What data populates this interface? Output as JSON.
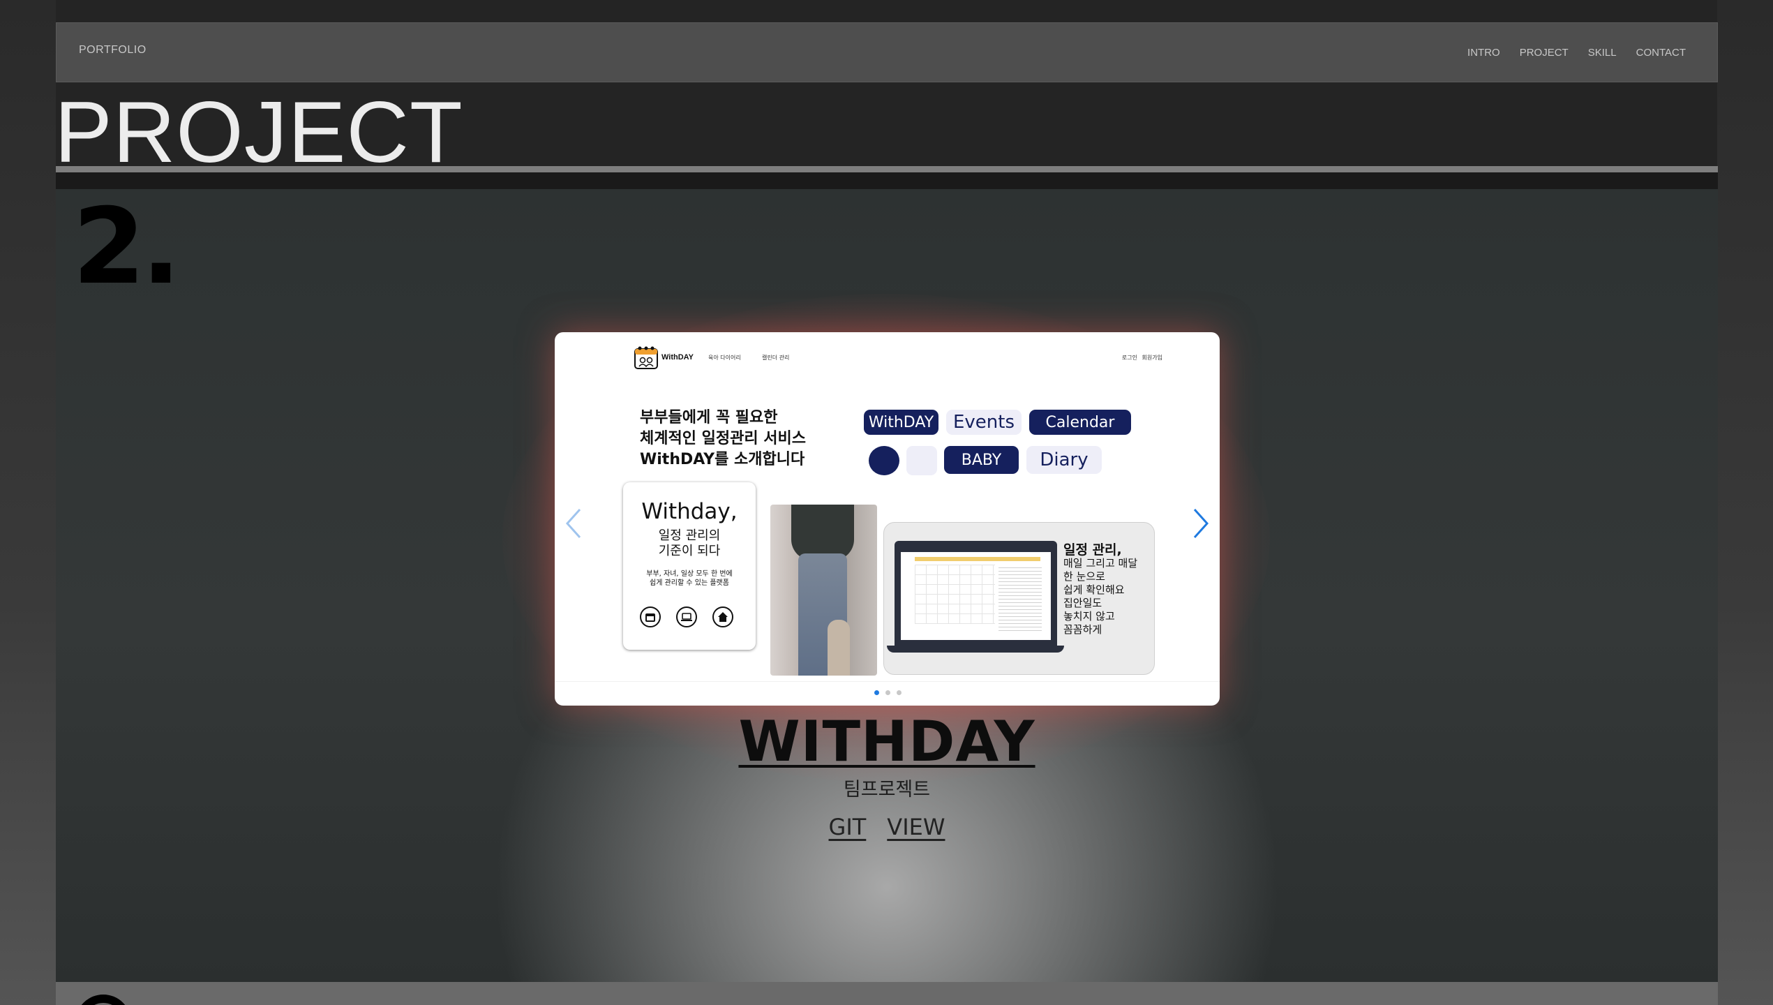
{
  "nav": {
    "brand": "PORTFOLIO",
    "links": [
      "INTRO",
      "PROJECT",
      "SKILL",
      "CONTACT"
    ]
  },
  "section": {
    "title": "PROJECT",
    "number": "2."
  },
  "slide": {
    "logo_text": "WithDAY",
    "menu_1": "육아 다이어리",
    "menu_2": "캘린더 관리",
    "login": "로그인",
    "signup": "회원가입",
    "headline": [
      "부부들에게 꼭 필요한",
      "체계적인 일정관리 서비스",
      "WithDAY를 소개합니다"
    ],
    "pills": [
      "WithDAY",
      "Events",
      "Calendar",
      "",
      "",
      "BABY",
      "Diary"
    ],
    "card_title": "Withday,",
    "card_subtitle": [
      "일정 관리의",
      "기준이 되다"
    ],
    "card_desc": [
      "부부, 자녀, 일상 모두 한 번에",
      "쉽게 관리할 수 있는 플랫폼"
    ],
    "laptop_text": [
      "일정 관리,",
      "매일 그리고 매달",
      "한 눈으로",
      "쉽게 확인해요",
      "집안일도",
      "놓치지 않고",
      "꼼꼼하게"
    ]
  },
  "carousel": {
    "prev_icon": "chevron-left-icon",
    "next_icon": "chevron-right-icon",
    "dot_count": 3,
    "active_index": 0,
    "accent": "#1f7ae0"
  },
  "project": {
    "name": "WITHDAY",
    "type": "팀프로젝트",
    "link_git": "GIT",
    "link_view": "VIEW"
  },
  "colors": {
    "navy": "#15205d",
    "glow": "#eb5f55"
  }
}
